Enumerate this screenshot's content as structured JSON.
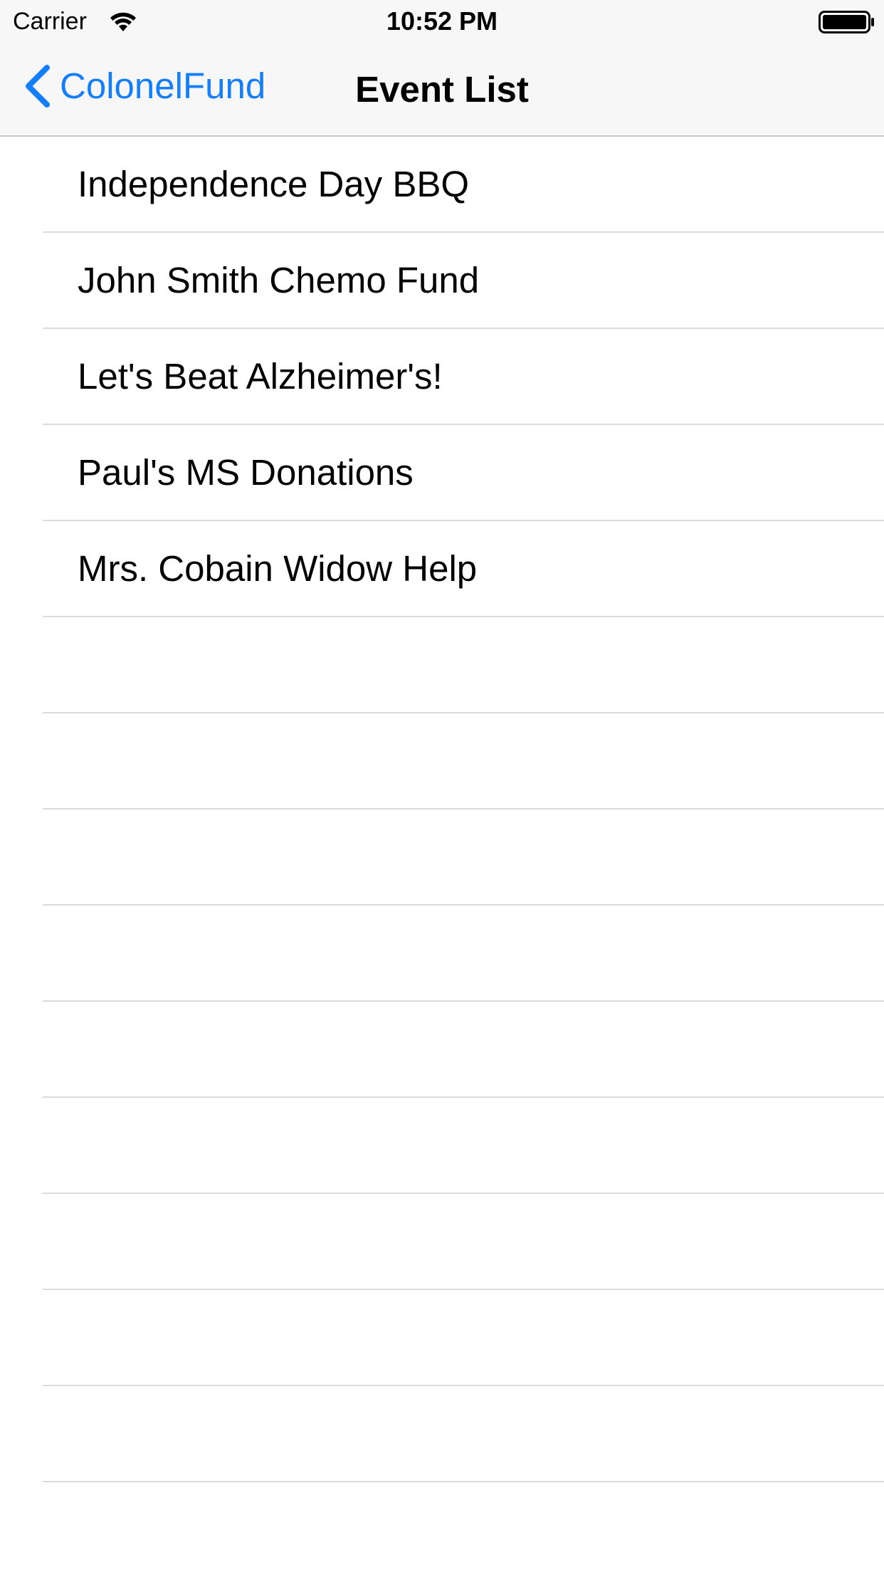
{
  "status_bar": {
    "carrier": "Carrier",
    "time": "10:52 PM",
    "icons": [
      "wifi-icon",
      "battery-icon"
    ]
  },
  "nav_bar": {
    "back_label": "ColonelFund",
    "title": "Event List",
    "accent_color": "#147efb"
  },
  "events": [
    "Independence Day BBQ",
    "John Smith Chemo Fund",
    "Let's Beat Alzheimer's!",
    "Paul's MS Donations",
    "Mrs. Cobain Widow Help"
  ]
}
